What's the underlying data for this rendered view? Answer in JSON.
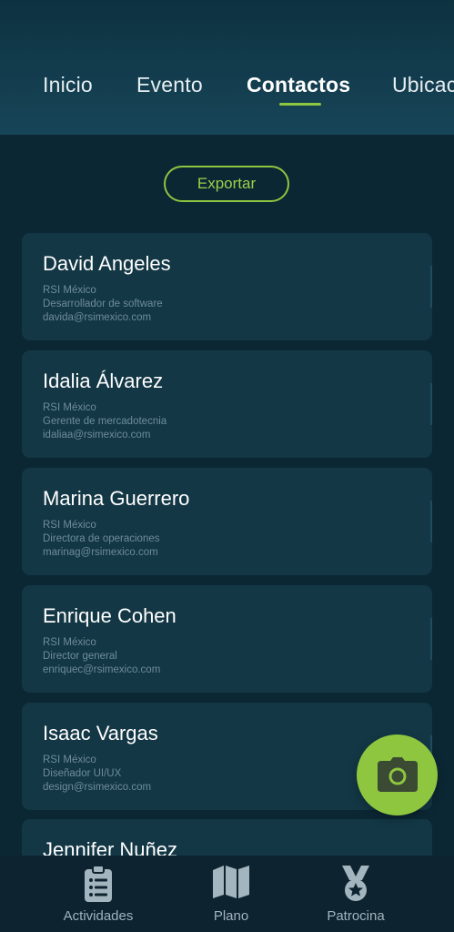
{
  "header": {
    "tabs": [
      {
        "label": "Inicio"
      },
      {
        "label": "Evento"
      },
      {
        "label": "Contactos",
        "active": true
      },
      {
        "label": "Ubicac"
      }
    ]
  },
  "actions": {
    "export_label": "Exportar"
  },
  "contacts": [
    {
      "name": "David Angeles",
      "company": "RSI México",
      "role": "Desarrollador de software",
      "email": "davida@rsimexico.com"
    },
    {
      "name": "Idalia Álvarez",
      "company": "RSI México",
      "role": "Gerente de mercadotecnia",
      "email": "idaliaa@rsimexico.com"
    },
    {
      "name": "Marina Guerrero",
      "company": "RSI México",
      "role": "Directora de operaciones",
      "email": "marinag@rsimexico.com"
    },
    {
      "name": "Enrique Cohen",
      "company": "RSI México",
      "role": "Director general",
      "email": "enriquec@rsimexico.com"
    },
    {
      "name": "Isaac Vargas",
      "company": "RSI México",
      "role": "Diseñador UI/UX",
      "email": "design@rsimexico.com"
    },
    {
      "name": "Jennifer Nuñez",
      "company": "",
      "role": "",
      "email": ""
    }
  ],
  "fab": {
    "icon": "camera-icon"
  },
  "bottom_nav": [
    {
      "label": "Actividades",
      "icon": "clipboard-list-icon"
    },
    {
      "label": "Plano",
      "icon": "map-icon"
    },
    {
      "label": "Patrocina",
      "icon": "medal-icon"
    }
  ],
  "colors": {
    "accent": "#8ec63f",
    "background": "#0b2734",
    "card": "#133745",
    "header_top": "#0d3240",
    "header_bottom": "#174558"
  }
}
